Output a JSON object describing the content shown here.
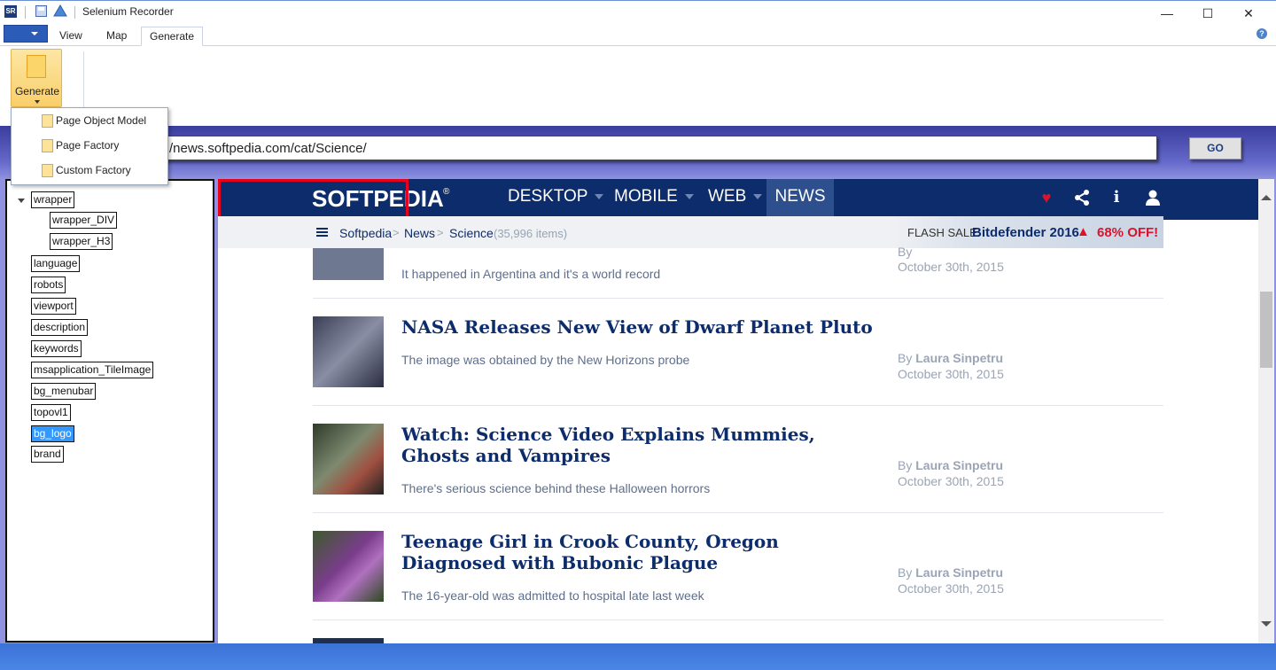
{
  "window": {
    "title": "Selenium Recorder",
    "app_icon_text": "SR",
    "minimize": "—",
    "maximize": "☐",
    "close": "✕"
  },
  "ribbon": {
    "tabs": [
      {
        "label": "View"
      },
      {
        "label": "Map"
      },
      {
        "label": "Generate",
        "active": true
      }
    ],
    "help": "?",
    "generate_label": "Generate"
  },
  "dropdown": {
    "items": [
      "Page Object Model",
      "Page Factory",
      "Custom Factory"
    ]
  },
  "address": {
    "url": "/news.softpedia.com/cat/Science/",
    "go_label": "GO"
  },
  "tree": {
    "nodes": [
      {
        "label": "wrapper"
      },
      {
        "label": "wrapper_DIV"
      },
      {
        "label": "wrapper_H3"
      },
      {
        "label": "language"
      },
      {
        "label": "robots"
      },
      {
        "label": "viewport"
      },
      {
        "label": "description"
      },
      {
        "label": "keywords"
      },
      {
        "label": "msapplication_TileImage"
      },
      {
        "label": "bg_menubar"
      },
      {
        "label": "topovl1"
      },
      {
        "label": "bg_logo",
        "selected": true
      },
      {
        "label": "brand"
      }
    ]
  },
  "site": {
    "logo": "SOFTPEDIA",
    "logo_reg": "®",
    "nav": [
      "DESKTOP",
      "MOBILE",
      "WEB",
      "NEWS"
    ],
    "crumbs": [
      "Softpedia",
      "News",
      "Science"
    ],
    "crumb_sep": ">",
    "crumb_count": "(35,996 items)",
    "flash_label": "FLASH SALE:",
    "flash_product": "Bitdefender 2016",
    "flash_off": "68% OFF!",
    "colors": {
      "nav_bg": "#0c2c6b",
      "news_active": "#2d4f8e",
      "flash_red": "#d9142a",
      "highlight": "#e8001c"
    }
  },
  "articles": [
    {
      "title": "",
      "subtitle": "It happened in Argentina and it's a world record",
      "by": "By",
      "author": "",
      "date": "October 30th, 2015"
    },
    {
      "title": "NASA Releases New View of Dwarf Planet Pluto",
      "subtitle": "The image was obtained by the New Horizons probe",
      "by": "By",
      "author": "Laura Sinpetru",
      "date": "October 30th, 2015"
    },
    {
      "title": "Watch: Science Video Explains Mummies, Ghosts and Vampires",
      "subtitle": "There's serious science behind these Halloween horrors",
      "by": "By",
      "author": "Laura Sinpetru",
      "date": "October 30th, 2015"
    },
    {
      "title": "Teenage Girl in Crook County, Oregon Diagnosed with Bubonic Plague",
      "subtitle": "The 16-year-old was admitted to hospital late last week",
      "by": "By",
      "author": "Laura Sinpetru",
      "date": "October 30th, 2015"
    }
  ]
}
